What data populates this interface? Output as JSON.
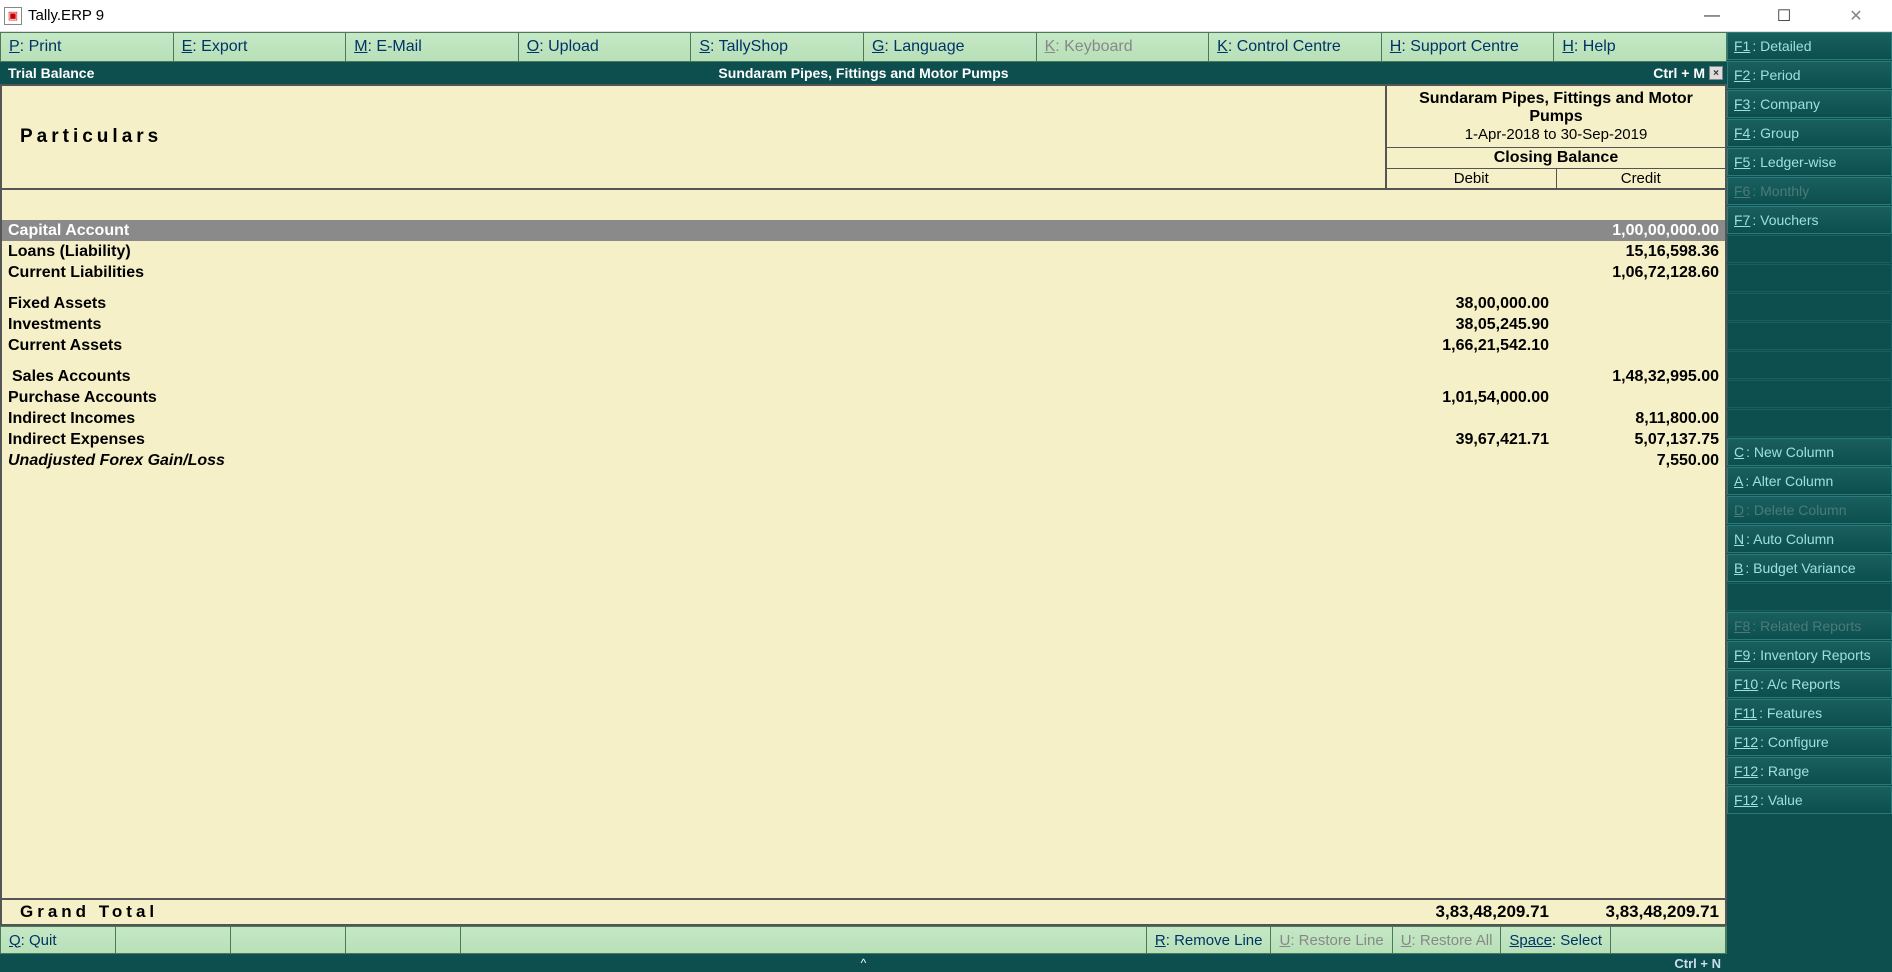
{
  "window": {
    "title": "Tally.ERP 9"
  },
  "top_menu": [
    {
      "hotkey": "P",
      "label": ": Print",
      "disabled": false
    },
    {
      "hotkey": "E",
      "label": ": Export",
      "disabled": false
    },
    {
      "hotkey": "M",
      "label": ": E-Mail",
      "disabled": false
    },
    {
      "hotkey": "O",
      "label": ": Upload",
      "disabled": false
    },
    {
      "hotkey": "S",
      "label": ": TallyShop",
      "disabled": false
    },
    {
      "hotkey": "G",
      "label": ": Language",
      "disabled": false
    },
    {
      "hotkey": "K",
      "label": ": Keyboard",
      "disabled": true
    },
    {
      "hotkey": "K",
      "label": ": Control Centre",
      "disabled": false
    },
    {
      "hotkey": "H",
      "label": ": Support Centre",
      "disabled": false
    },
    {
      "hotkey": "H",
      "label": ": Help",
      "disabled": false
    }
  ],
  "report_bar": {
    "left": "Trial Balance",
    "center": "Sundaram Pipes, Fittings and Motor Pumps",
    "shortcut": "Ctrl + M"
  },
  "header": {
    "particulars": "Particulars",
    "company": "Sundaram Pipes, Fittings and Motor Pumps",
    "period": "1-Apr-2018 to 30-Sep-2019",
    "closing": "Closing Balance",
    "debit": "Debit",
    "credit": "Credit"
  },
  "rows": [
    {
      "name": "Capital Account",
      "debit": "",
      "credit": "1,00,00,000.00",
      "selected": true,
      "bold": true
    },
    {
      "name": "Loans (Liability)",
      "debit": "",
      "credit": "15,16,598.36",
      "bold": true
    },
    {
      "name": "Current Liabilities",
      "debit": "",
      "credit": "1,06,72,128.60",
      "bold": true
    },
    {
      "spacer": true
    },
    {
      "name": "Fixed Assets",
      "debit": "38,00,000.00",
      "credit": "",
      "bold": true
    },
    {
      "name": "Investments",
      "debit": "38,05,245.90",
      "credit": "",
      "bold": true
    },
    {
      "name": "Current Assets",
      "debit": "1,66,21,542.10",
      "credit": "",
      "bold": true
    },
    {
      "spacer": true
    },
    {
      "name": "Sales Accounts",
      "debit": "",
      "credit": "1,48,32,995.00",
      "bold": true,
      "indent": true
    },
    {
      "name": "Purchase Accounts",
      "debit": "1,01,54,000.00",
      "credit": "",
      "bold": true
    },
    {
      "name": "Indirect Incomes",
      "debit": "",
      "credit": "8,11,800.00",
      "bold": true
    },
    {
      "name": "Indirect Expenses",
      "debit": "39,67,421.71",
      "credit": "5,07,137.75",
      "bold": true
    },
    {
      "name": "Unadjusted Forex Gain/Loss",
      "debit": "",
      "credit": "7,550.00",
      "italic": true
    }
  ],
  "grand_total": {
    "label": "Grand Total",
    "debit": "3,83,48,209.71",
    "credit": "3,83,48,209.71"
  },
  "bottom_bar": {
    "quit": {
      "hotkey": "Q",
      "label": ": Quit"
    },
    "remove": {
      "hotkey": "R",
      "label": ": Remove Line"
    },
    "restore_line": {
      "hotkey": "U",
      "label": ": Restore Line"
    },
    "restore_all": {
      "hotkey": "U",
      "label": ": Restore All"
    },
    "select": {
      "hotkey": "Space",
      "label": ": Select"
    }
  },
  "status_bar": {
    "right": "Ctrl + N"
  },
  "side_panel": [
    {
      "fkey": "F1",
      "label": ": Detailed"
    },
    {
      "fkey": "F2",
      "label": ": Period"
    },
    {
      "fkey": "F3",
      "label": ": Company"
    },
    {
      "fkey": "F4",
      "label": ": Group"
    },
    {
      "fkey": "F5",
      "label": ": Ledger-wise"
    },
    {
      "fkey": "F6",
      "label": ": Monthly",
      "disabled": true
    },
    {
      "fkey": "F7",
      "label": ": Vouchers"
    },
    {
      "empty": true
    },
    {
      "empty": true
    },
    {
      "empty": true
    },
    {
      "empty": true
    },
    {
      "empty": true
    },
    {
      "empty": true
    },
    {
      "empty": true
    },
    {
      "fkey": "C",
      "label": ": New Column"
    },
    {
      "fkey": "A",
      "label": ": Alter Column"
    },
    {
      "fkey": "D",
      "label": ": Delete Column",
      "disabled": true
    },
    {
      "fkey": "N",
      "label": ": Auto Column"
    },
    {
      "fkey": "B",
      "label": ": Budget Variance"
    },
    {
      "empty": true
    },
    {
      "fkey": "F8",
      "label": ": Related Reports",
      "disabled": true
    },
    {
      "fkey": "F9",
      "label": ": Inventory Reports"
    },
    {
      "fkey": "F10",
      "label": ": A/c Reports"
    },
    {
      "fkey": "F11",
      "label": ": Features"
    },
    {
      "fkey": "F12",
      "label": ": Configure"
    },
    {
      "fkey": "F12",
      "label": ": Range"
    },
    {
      "fkey": "F12",
      "label": ": Value"
    }
  ]
}
